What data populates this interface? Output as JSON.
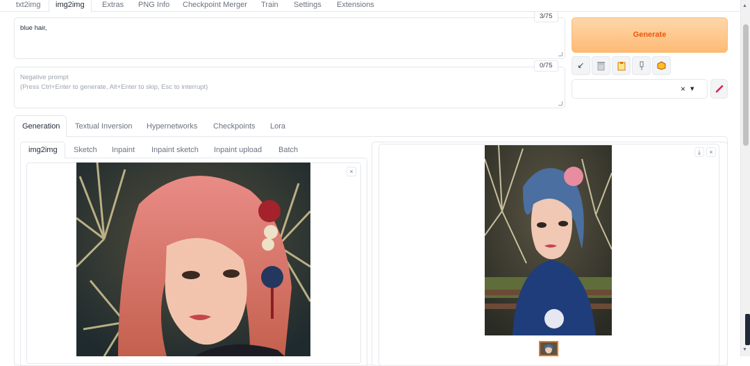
{
  "top_tabs": [
    {
      "label": "txt2img"
    },
    {
      "label": "img2img"
    },
    {
      "label": "Extras"
    },
    {
      "label": "PNG Info"
    },
    {
      "label": "Checkpoint Merger"
    },
    {
      "label": "Train"
    },
    {
      "label": "Settings"
    },
    {
      "label": "Extensions"
    }
  ],
  "prompt": {
    "value": "blue hair,",
    "counter": "3/75"
  },
  "negative_prompt": {
    "placeholder_line1": "Negative prompt",
    "placeholder_line2": "(Press Ctrl+Enter to generate, Alt+Enter to skip, Esc to interrupt)",
    "counter": "0/75"
  },
  "generate_label": "Generate",
  "tool_buttons": [
    {
      "icon": "arrow-down-left-icon",
      "glyph": "↙"
    },
    {
      "icon": "trash-icon",
      "glyph": "🗑"
    },
    {
      "icon": "clipboard-icon",
      "glyph": "📋"
    },
    {
      "icon": "pin-icon",
      "glyph": "📌"
    },
    {
      "icon": "box-icon",
      "glyph": "📦"
    }
  ],
  "style_select": {
    "clear": "×",
    "dropdown": "▾"
  },
  "edit_icon_glyph": "🖌",
  "gen_tabs": [
    {
      "label": "Generation"
    },
    {
      "label": "Textual Inversion"
    },
    {
      "label": "Hypernetworks"
    },
    {
      "label": "Checkpoints"
    },
    {
      "label": "Lora"
    }
  ],
  "input_tabs": [
    {
      "label": "img2img"
    },
    {
      "label": "Sketch"
    },
    {
      "label": "Inpaint"
    },
    {
      "label": "Inpaint sketch"
    },
    {
      "label": "Inpaint upload"
    },
    {
      "label": "Batch"
    }
  ],
  "close_glyph": "×",
  "download_glyph": "⤓"
}
